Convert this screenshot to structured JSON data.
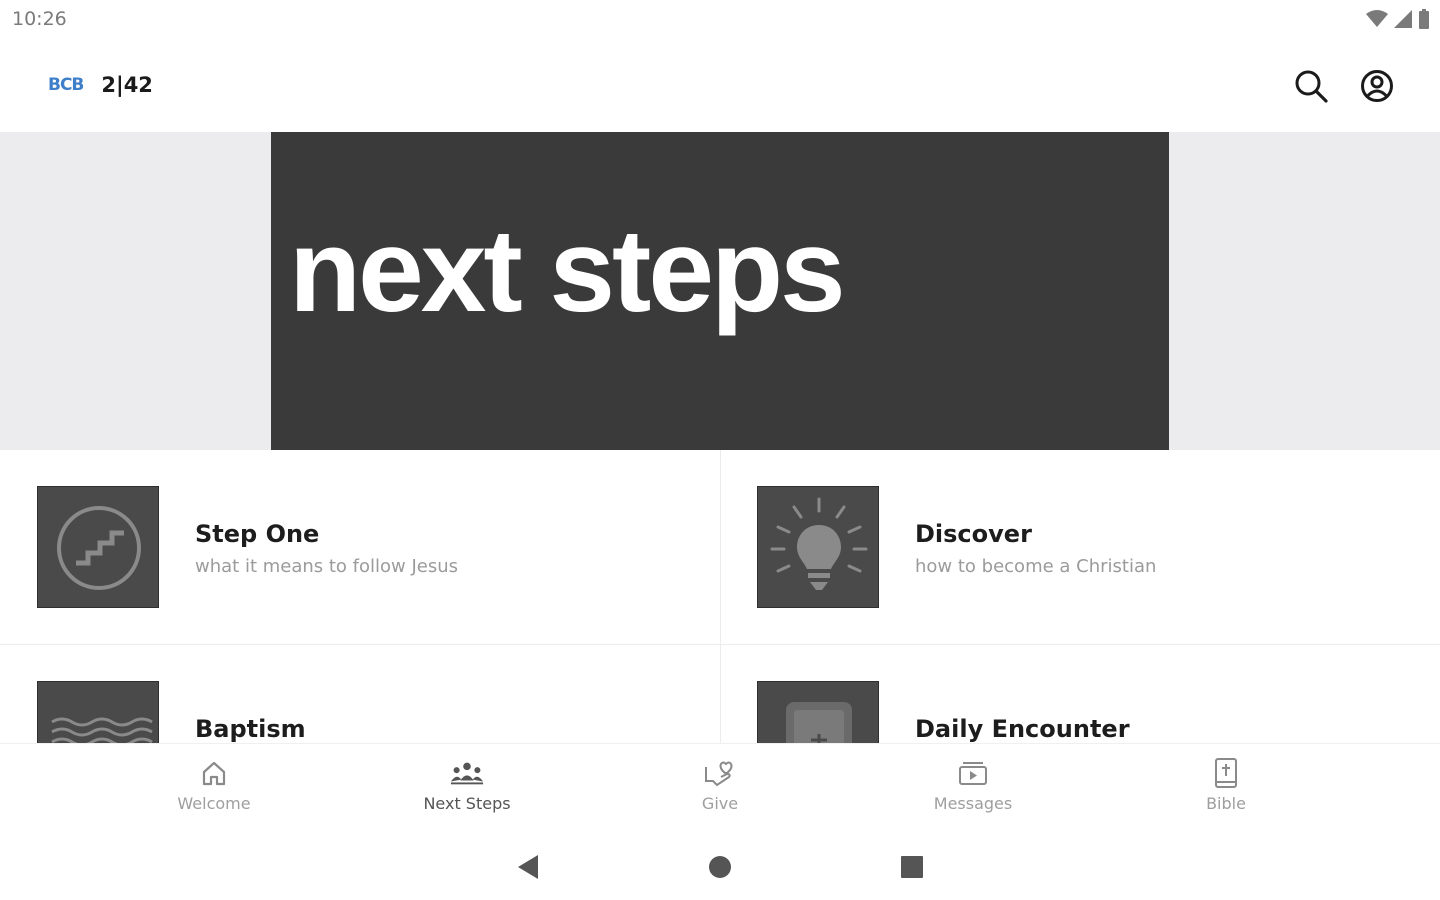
{
  "status_bar": {
    "time": "10:26"
  },
  "app_bar": {
    "logo_mark": "BCB",
    "logo_text": "2|42"
  },
  "hero": {
    "title": "next steps"
  },
  "tiles": [
    {
      "title": "Step One",
      "subtitle": "what it means to follow Jesus",
      "icon": "stairs-icon"
    },
    {
      "title": "Discover",
      "subtitle": "how to become a Christian",
      "icon": "lightbulb-icon"
    },
    {
      "title": "Baptism",
      "subtitle": "",
      "icon": "water-waves-icon"
    },
    {
      "title": "Daily Encounter",
      "subtitle": "",
      "icon": "bible-book-icon"
    }
  ],
  "bottom_nav": [
    {
      "label": "Welcome",
      "icon": "home-icon",
      "active": false
    },
    {
      "label": "Next Steps",
      "icon": "people-group-icon",
      "active": true
    },
    {
      "label": "Give",
      "icon": "heart-hand-icon",
      "active": false
    },
    {
      "label": "Messages",
      "icon": "video-folder-icon",
      "active": false
    },
    {
      "label": "Bible",
      "icon": "bible-icon",
      "active": false
    }
  ],
  "colors": {
    "hero_card": "#3a3a3a",
    "hero_backdrop": "#ececee",
    "tile_thumb": "#4a4a4a",
    "logo_accent": "#3f7ec9",
    "subtitle_text": "#9b9b9b"
  }
}
